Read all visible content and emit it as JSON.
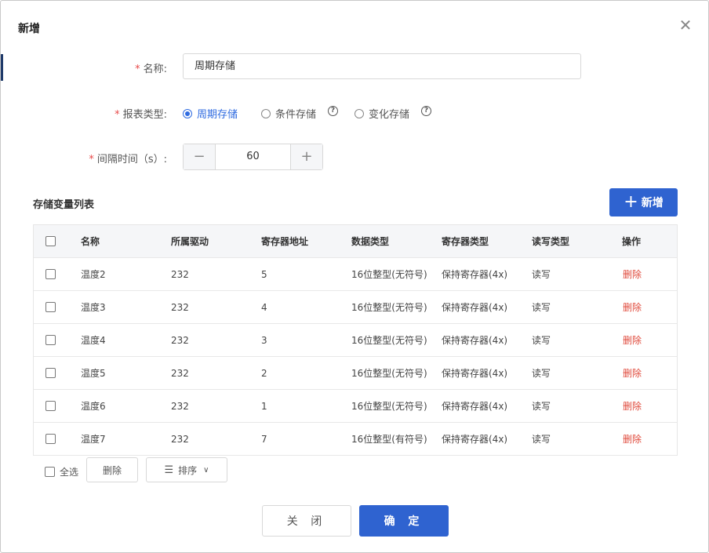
{
  "dialog": {
    "title": "新增",
    "close_icon": "close-icon"
  },
  "form": {
    "name": {
      "label": "名称:",
      "value": "周期存储"
    },
    "report_type": {
      "label": "报表类型:",
      "options": [
        {
          "label": "周期存储",
          "selected": true
        },
        {
          "label": "条件存储",
          "selected": false
        },
        {
          "label": "变化存储",
          "selected": false
        }
      ]
    },
    "interval": {
      "label": "间隔时间（s）:",
      "value": "60"
    }
  },
  "variable_list": {
    "title": "存储变量列表",
    "add_button": "新增",
    "columns": [
      "名称",
      "所属驱动",
      "寄存器地址",
      "数据类型",
      "寄存器类型",
      "读写类型",
      "操作"
    ],
    "rows": [
      {
        "name": "温度2",
        "driver": "232",
        "address": "5",
        "data_type": "16位整型(无符号)",
        "reg_type": "保持寄存器(4x)",
        "rw": "读写",
        "action": "删除"
      },
      {
        "name": "温度3",
        "driver": "232",
        "address": "4",
        "data_type": "16位整型(无符号)",
        "reg_type": "保持寄存器(4x)",
        "rw": "读写",
        "action": "删除"
      },
      {
        "name": "温度4",
        "driver": "232",
        "address": "3",
        "data_type": "16位整型(无符号)",
        "reg_type": "保持寄存器(4x)",
        "rw": "读写",
        "action": "删除"
      },
      {
        "name": "温度5",
        "driver": "232",
        "address": "2",
        "data_type": "16位整型(无符号)",
        "reg_type": "保持寄存器(4x)",
        "rw": "读写",
        "action": "删除"
      },
      {
        "name": "温度6",
        "driver": "232",
        "address": "1",
        "data_type": "16位整型(无符号)",
        "reg_type": "保持寄存器(4x)",
        "rw": "读写",
        "action": "删除"
      },
      {
        "name": "温度7",
        "driver": "232",
        "address": "7",
        "data_type": "16位整型(有符号)",
        "reg_type": "保持寄存器(4x)",
        "rw": "读写",
        "action": "删除"
      }
    ]
  },
  "bulk": {
    "select_all": "全选",
    "delete": "删除",
    "sort": "排序"
  },
  "footer": {
    "close": "关 闭",
    "confirm": "确 定"
  },
  "colors": {
    "primary": "#2f63d0",
    "danger": "#e04a3c",
    "required": "#e84a4a"
  }
}
